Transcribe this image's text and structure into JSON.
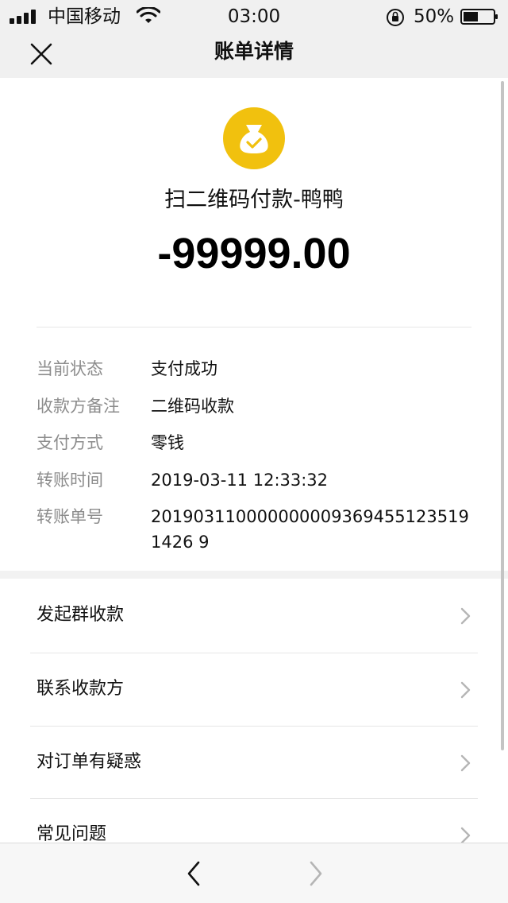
{
  "status_bar": {
    "carrier": "中国移动",
    "time": "03:00",
    "battery_percent": "50%",
    "battery_level": 0.5
  },
  "nav": {
    "title": "账单详情",
    "close_icon": "close-icon"
  },
  "bill": {
    "icon": "money-bag-check-icon",
    "merchant": "扫二维码付款-鸭鸭",
    "amount": "-99999.00",
    "rows": [
      {
        "label": "当前状态",
        "value": "支付成功"
      },
      {
        "label": "收款方备注",
        "value": "二维码收款"
      },
      {
        "label": "支付方式",
        "value": "零钱"
      },
      {
        "label": "转账时间",
        "value": "2019-03-11 12:33:32"
      },
      {
        "label": "转账单号",
        "value": "2019031100000000093694551235191426 9"
      }
    ]
  },
  "actions": [
    {
      "label": "发起群收款"
    },
    {
      "label": "联系收款方"
    },
    {
      "label": "对订单有疑惑"
    },
    {
      "label": "常见问题"
    }
  ],
  "colors": {
    "accent_yellow": "#f1c10e",
    "label_gray": "#8c8c8c",
    "background": "#f2f2f2"
  }
}
